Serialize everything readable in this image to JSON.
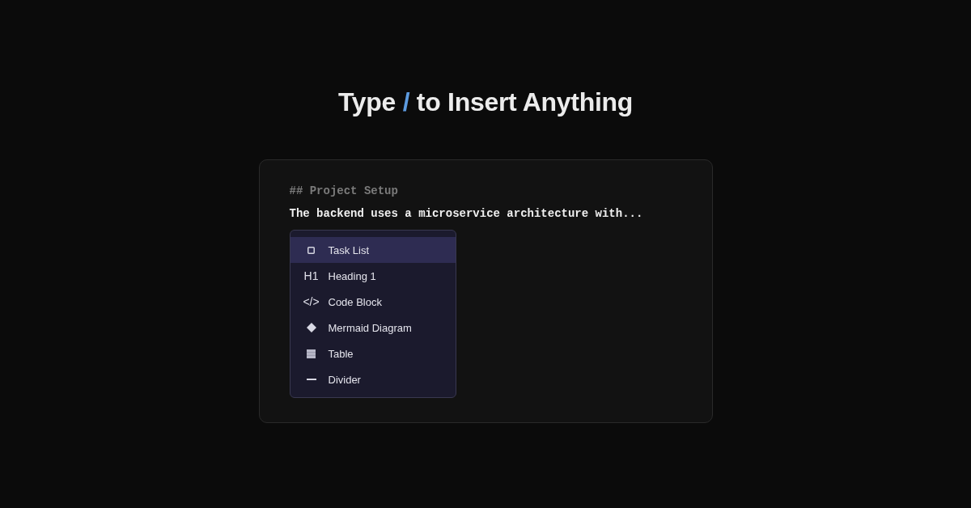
{
  "title": {
    "before": "Type",
    "key": "/",
    "after": "to Insert Anything"
  },
  "editor": {
    "heading": "## Project Setup",
    "line": "The backend uses a microservice architecture with...",
    "menu": {
      "items": [
        {
          "label": "Task List",
          "kind": "checkbox",
          "selected": true
        },
        {
          "label": "Heading 1",
          "kind": "glyph",
          "glyph": "H1",
          "selected": false
        },
        {
          "label": "Code Block",
          "kind": "glyph",
          "glyph": "</>",
          "selected": false
        },
        {
          "label": "Mermaid Diagram",
          "kind": "diamond",
          "selected": false
        },
        {
          "label": "Table",
          "kind": "grid",
          "selected": false
        },
        {
          "label": "Divider",
          "kind": "rule",
          "selected": false
        }
      ]
    }
  }
}
